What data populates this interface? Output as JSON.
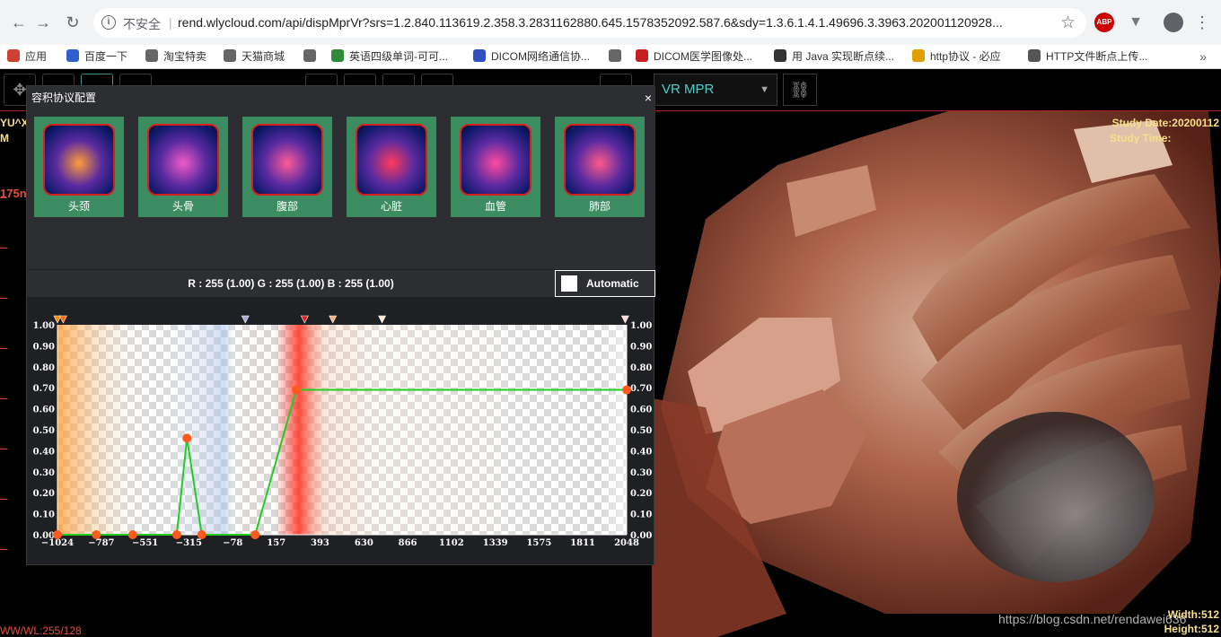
{
  "browser": {
    "security_label": "不安全",
    "url": "rend.wlycloud.com/api/dispMprVr?srs=1.2.840.113619.2.358.3.2831162880.645.1578352092.587.6&sdy=1.3.6.1.4.1.49696.3.3963.202001120928...",
    "ext_abp": "ABP",
    "bookmarks": [
      {
        "label": "应用",
        "color": "#d04030"
      },
      {
        "label": "百度一下",
        "color": "#3060d0"
      },
      {
        "label": "淘宝特卖",
        "color": "#666666"
      },
      {
        "label": "天猫商城",
        "color": "#666666"
      },
      {
        "label": "",
        "color": "#666666"
      },
      {
        "label": "英语四级单词-可可...",
        "color": "#2e8b3a"
      },
      {
        "label": "DICOM网络通信协...",
        "color": "#3050c0"
      },
      {
        "label": "",
        "color": "#666666"
      },
      {
        "label": "DICOM医学图像处...",
        "color": "#c82020"
      },
      {
        "label": "用 Java 实现断点续...",
        "color": "#333333"
      },
      {
        "label": "http协议 - 必应",
        "color": "#e0a000"
      },
      {
        "label": "HTTP文件断点上传...",
        "color": "#555555"
      }
    ]
  },
  "toolbar": {
    "render_mode": "VR MPR"
  },
  "overlay": {
    "study_date": "Study Date:20200112",
    "study_time": "Study Time:",
    "patient_name": "YU^X",
    "patient_sex": "M",
    "slice_label": "175n",
    "ww_wl": "WW/WL:255/128",
    "width": "Width:512",
    "height": "Height:512",
    "watermark": "https://blog.csdn.net/rendawei636"
  },
  "dialog": {
    "title": "容积协议配置",
    "close": "×",
    "presets": [
      {
        "label": "头颈",
        "icon": "head-neck-icon",
        "hue": "#ff9c3a"
      },
      {
        "label": "头骨",
        "icon": "skull-icon",
        "hue": "#f05ac8"
      },
      {
        "label": "腹部",
        "icon": "abdomen-icon",
        "hue": "#ff5a9a"
      },
      {
        "label": "心脏",
        "icon": "heart-icon",
        "hue": "#ff3a5a"
      },
      {
        "label": "血管",
        "icon": "vessel-icon",
        "hue": "#ff4aa0"
      },
      {
        "label": "肺部",
        "icon": "lung-icon",
        "hue": "#ff5a8a"
      }
    ],
    "rgb_text": "R : 255 (1.00) G : 255 (1.00) B : 255 (1.00)",
    "automatic_label": "Automatic"
  },
  "chart_data": {
    "type": "line",
    "title": "",
    "xlabel": "",
    "ylabel": "",
    "xlim": [
      -1024,
      2048
    ],
    "ylim": [
      0,
      1
    ],
    "x_tick_labels": [
      "-1024",
      "-787",
      "-551",
      "-315",
      "-78",
      "157",
      "393",
      "630",
      "866",
      "1102",
      "1339",
      "1575",
      "1811",
      "2048"
    ],
    "y_tick_labels": [
      "0.00",
      "0.10",
      "0.20",
      "0.30",
      "0.40",
      "0.50",
      "0.60",
      "0.70",
      "0.80",
      "0.90",
      "1.00"
    ],
    "opacity_points": [
      {
        "x": -1024,
        "y": 0.0
      },
      {
        "x": -814,
        "y": 0.0
      },
      {
        "x": -618,
        "y": 0.0
      },
      {
        "x": -380,
        "y": 0.0
      },
      {
        "x": -325,
        "y": 0.46
      },
      {
        "x": -245,
        "y": 0.0
      },
      {
        "x": 43,
        "y": 0.0
      },
      {
        "x": 265,
        "y": 0.69
      },
      {
        "x": 2048,
        "y": 0.69
      }
    ],
    "color_stops": [
      {
        "x": -1024,
        "color": "#ff8a00"
      },
      {
        "x": -993,
        "color": "#ff6a10"
      },
      {
        "x": -10,
        "color": "#b0a8d8"
      },
      {
        "x": 310,
        "color": "#e02020"
      },
      {
        "x": 462,
        "color": "#ffb080"
      },
      {
        "x": 728,
        "color": "#ffe8d8"
      },
      {
        "x": 2040,
        "color": "#ffd8d8"
      }
    ],
    "line_color": "#22cc22",
    "point_color": "#ff5a1e",
    "grid": false
  }
}
